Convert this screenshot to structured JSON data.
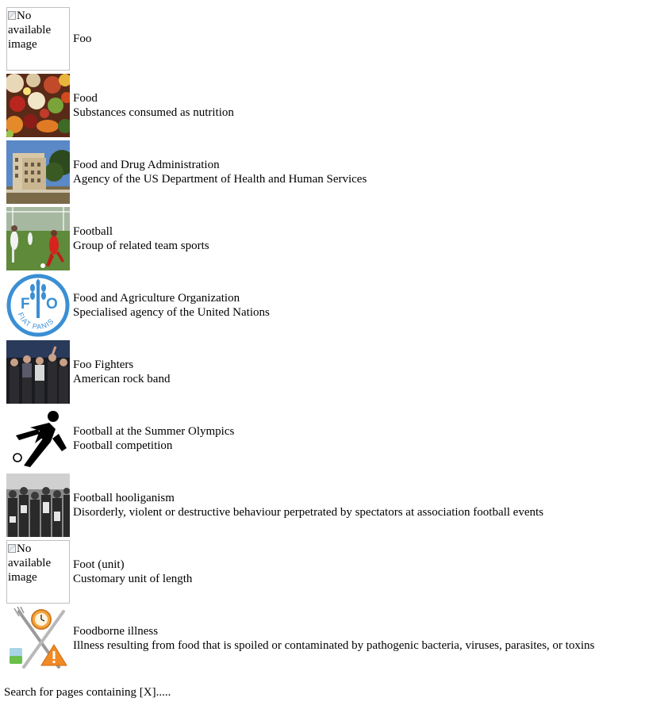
{
  "results": [
    {
      "title": "Foo",
      "description": "",
      "image": "broken",
      "alt": "No available image"
    },
    {
      "title": "Food",
      "description": "Substances consumed as nutrition",
      "image": "food-photo"
    },
    {
      "title": "Food and Drug Administration",
      "description": "Agency of the US Department of Health and Human Services",
      "image": "building-photo"
    },
    {
      "title": "Football",
      "description": "Group of related team sports",
      "image": "football-match-photo"
    },
    {
      "title": "Food and Agriculture Organization",
      "description": "Specialised agency of the United Nations",
      "image": "fao-logo",
      "logo_text": {
        "letters": "FAO",
        "motto": "FIAT PANIS"
      }
    },
    {
      "title": "Foo Fighters",
      "description": "American rock band",
      "image": "band-photo"
    },
    {
      "title": "Football at the Summer Olympics",
      "description": "Football competition",
      "image": "olympic-pictogram"
    },
    {
      "title": "Football hooliganism",
      "description": "Disorderly, violent or destructive behaviour perpetrated by spectators at association football events",
      "image": "crowd-photo"
    },
    {
      "title": "Foot (unit)",
      "description": "Customary unit of length",
      "image": "broken",
      "alt": "No available image"
    },
    {
      "title": "Foodborne illness",
      "description": "Illness resulting from food that is spoiled or contaminated by pathogenic bacteria, viruses, parasites, or toxins",
      "image": "foodborne-illness-icon"
    }
  ],
  "footer": {
    "text": "Search for pages containing [X]....."
  },
  "colors": {
    "fao_blue": "#3b8fd4",
    "warning_orange": "#f08a24",
    "broken_border": "#c0c0c0"
  }
}
